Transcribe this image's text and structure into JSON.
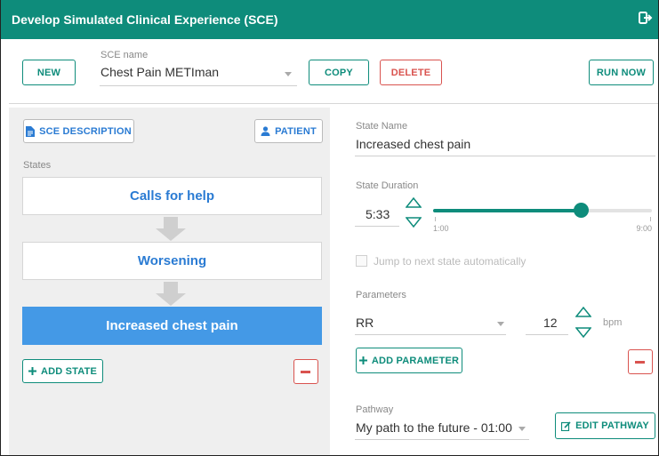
{
  "titlebar": {
    "title": "Develop Simulated Clinical Experience (SCE)",
    "exit_icon": "exit-icon"
  },
  "toolbar": {
    "new_label": "NEW",
    "sce_name_label": "SCE name",
    "sce_name_value": "Chest Pain METIman",
    "copy_label": "COPY",
    "delete_label": "DELETE",
    "run_now_label": "RUN NOW"
  },
  "left": {
    "sce_description_label": "SCE DESCRIPTION",
    "patient_label": "PATIENT",
    "states_label": "States",
    "states": [
      {
        "label": "Calls for help",
        "active": false
      },
      {
        "label": "Worsening",
        "active": false
      },
      {
        "label": "Increased chest pain",
        "active": true
      }
    ],
    "add_state_label": "ADD STATE"
  },
  "right": {
    "state_name_label": "State Name",
    "state_name_value": "Increased chest pain",
    "state_duration_label": "State Duration",
    "state_duration_value": "5:33",
    "slider": {
      "min_label": "1:00",
      "max_label": "9:00",
      "level": 0.68
    },
    "jump_label": "Jump to next state automatically",
    "jump_checked": false,
    "parameters_label": "Parameters",
    "parameter_name": "RR",
    "parameter_value": "12",
    "parameter_unit": "bpm",
    "add_parameter_label": "ADD PARAMETER",
    "pathway_label": "Pathway",
    "pathway_value": "My path to the future - 01:00",
    "edit_pathway_label": "EDIT PATHWAY"
  },
  "colors": {
    "accent": "#0e8c7b",
    "danger": "#d9534f",
    "link": "#2a7bd3",
    "active_state": "#4499e6"
  }
}
